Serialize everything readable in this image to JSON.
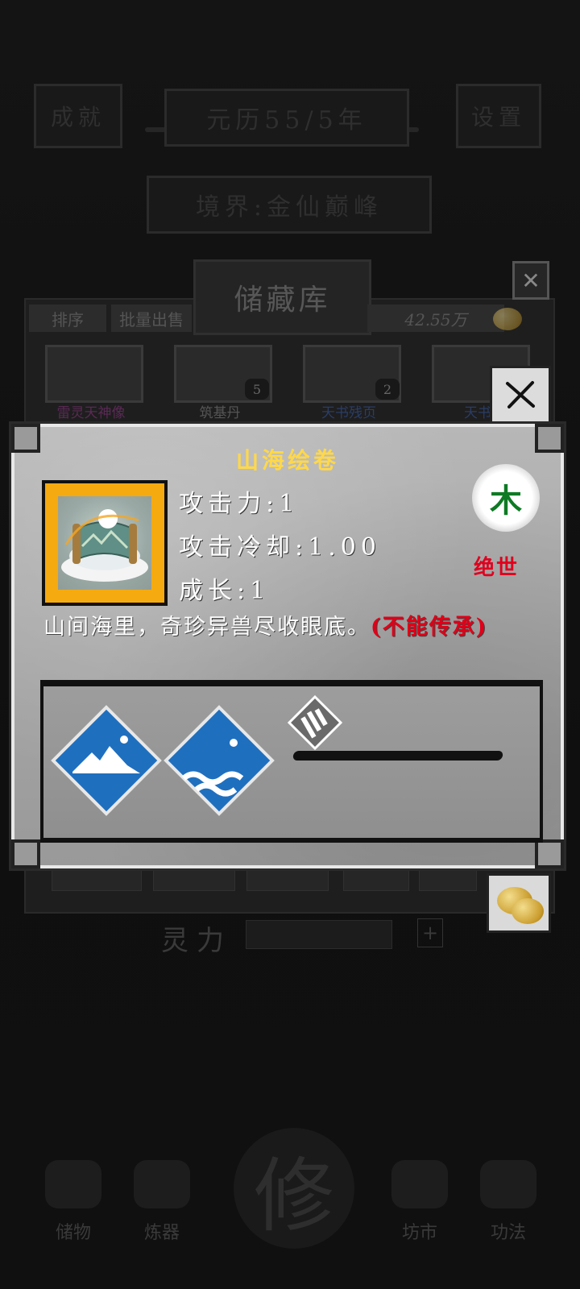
{
  "header": {
    "left_badge": "成就",
    "date": "元历55/5年",
    "settings": "设置",
    "realm": "境界:金仙巅峰"
  },
  "storage": {
    "title": "储藏库",
    "sort_label": "排序",
    "bulk_sell_label": "批量出售",
    "coins": "42.55万",
    "slots": [
      {
        "label": "雷灵天神像",
        "count": ""
      },
      {
        "label": "筑基丹",
        "count": "5"
      },
      {
        "label": "天书残页",
        "count": "2"
      },
      {
        "label": "天书",
        "count": ""
      }
    ]
  },
  "item_dialog": {
    "name": "山海绘卷",
    "element": "木",
    "rarity": "绝世",
    "stats": {
      "attack": "攻击力:1",
      "cooldown": "攻击冷却:1.00",
      "growth": "成长:1"
    },
    "description": "山间海里，奇珍异兽尽收眼底。",
    "note": "(不能传承)",
    "colors": {
      "title": "#ffd84a",
      "element": "#0e7a24",
      "rarity": "#e00018",
      "skill_blue": "#1f6fbf",
      "icon_frame": "#f5aa10"
    },
    "skills": [
      "mountain-skill-icon",
      "sea-skill-icon",
      "flag-skill-icon"
    ]
  },
  "bottom": {
    "power_label": "灵力",
    "power_value": "",
    "plus": "+",
    "nav": [
      "储物",
      "炼器",
      "修",
      "坊市",
      "功法"
    ]
  }
}
